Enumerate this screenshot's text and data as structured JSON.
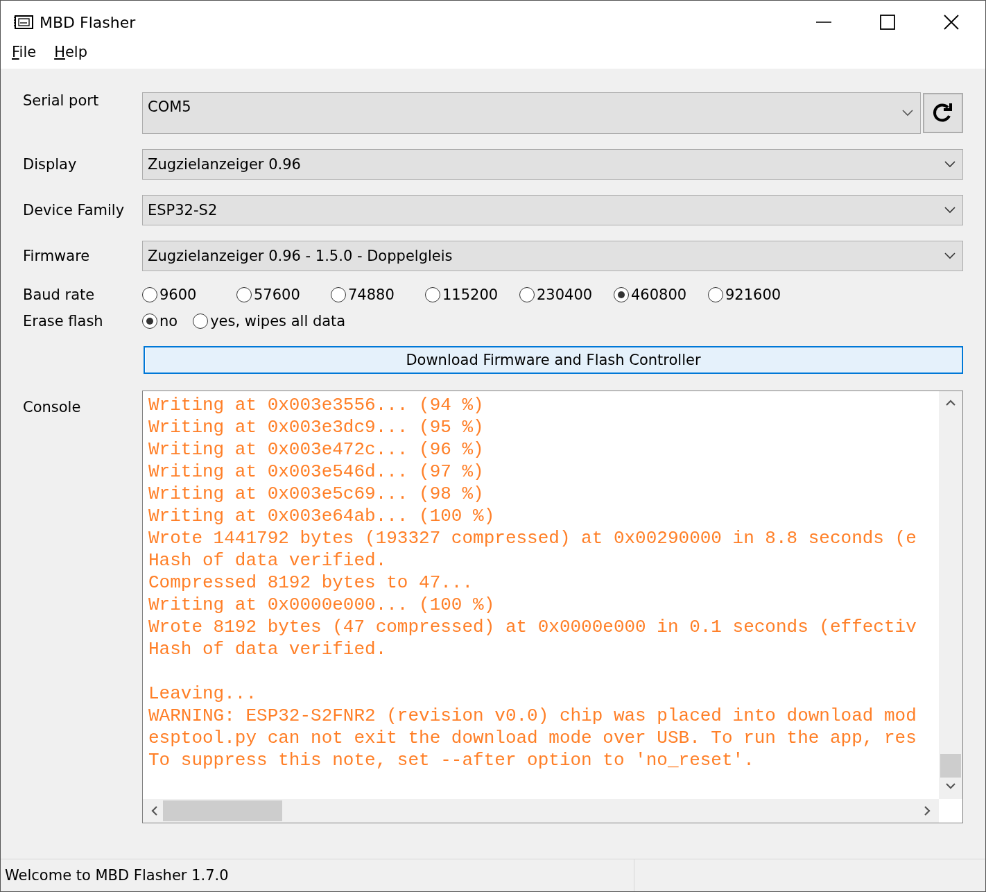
{
  "window": {
    "title": "MBD Flasher"
  },
  "menu": [
    {
      "label": "File"
    },
    {
      "label": "Help"
    }
  ],
  "form": {
    "serial_port": {
      "label": "Serial port",
      "value": "COM5"
    },
    "display": {
      "label": "Display",
      "value": "Zugzielanzeiger 0.96"
    },
    "device_family": {
      "label": "Device Family",
      "value": "ESP32-S2"
    },
    "firmware": {
      "label": "Firmware",
      "value": "Zugzielanzeiger 0.96 - 1.5.0 - Doppelgleis"
    },
    "baud_rate": {
      "label": "Baud rate",
      "options": [
        {
          "label": "9600",
          "selected": false
        },
        {
          "label": "57600",
          "selected": false
        },
        {
          "label": "74880",
          "selected": false
        },
        {
          "label": "115200",
          "selected": false
        },
        {
          "label": "230400",
          "selected": false
        },
        {
          "label": "460800",
          "selected": true
        },
        {
          "label": "921600",
          "selected": false
        }
      ]
    },
    "erase_flash": {
      "label": "Erase flash",
      "options": [
        {
          "label": "no",
          "selected": true
        },
        {
          "label": "yes, wipes all data",
          "selected": false
        }
      ]
    },
    "action_button": "Download Firmware and Flash Controller"
  },
  "console": {
    "label": "Console",
    "blocks": [
      [
        "Writing at 0x003e3556... (94 %)",
        "Writing at 0x003e3dc9... (95 %)",
        "Writing at 0x003e472c... (96 %)",
        "Writing at 0x003e546d... (97 %)",
        "Writing at 0x003e5c69... (98 %)",
        "Writing at 0x003e64ab... (100 %)",
        "Wrote 1441792 bytes (193327 compressed) at 0x00290000 in 8.8 seconds (e",
        "Hash of data verified.",
        "Compressed 8192 bytes to 47...",
        "Writing at 0x0000e000... (100 %)",
        "Wrote 8192 bytes (47 compressed) at 0x0000e000 in 0.1 seconds (effectiv",
        "Hash of data verified."
      ],
      [
        "Leaving...",
        "WARNING: ESP32-S2FNR2 (revision v0.0) chip was placed into download mod",
        "esptool.py can not exit the download mode over USB. To run the app, res",
        "To suppress this note, set --after option to 'no_reset'."
      ]
    ]
  },
  "status_bar": {
    "text": "Welcome to MBD Flasher 1.7.0"
  }
}
